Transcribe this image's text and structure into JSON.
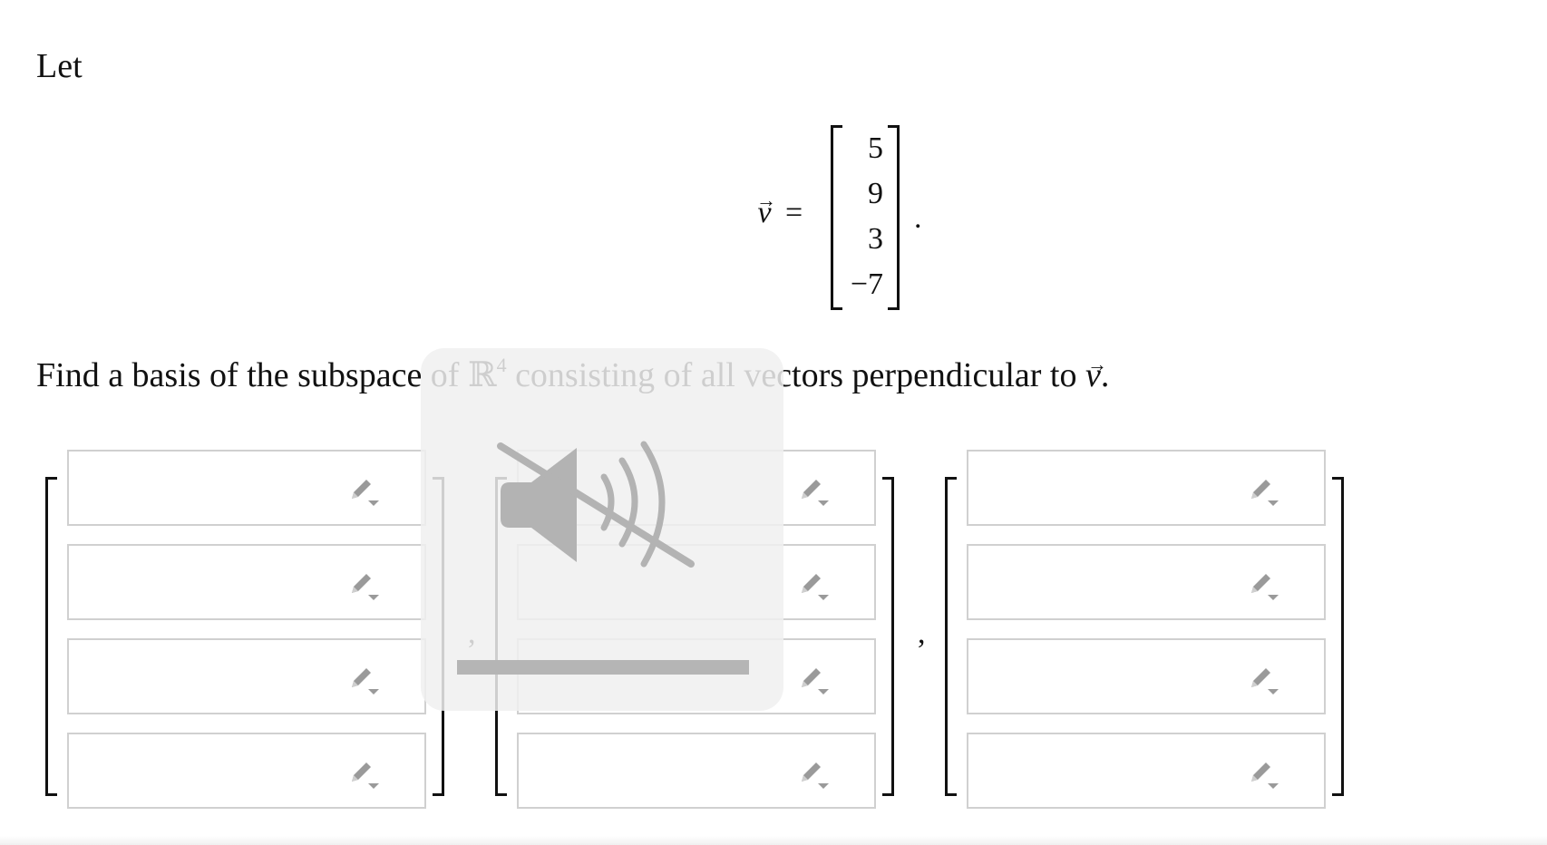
{
  "intro": "Let",
  "vector": {
    "symbol": "v",
    "arrow": "→",
    "equals": "=",
    "entries": [
      "5",
      "9",
      "3",
      "−7"
    ],
    "period": "."
  },
  "question": {
    "part1": "Find a basis of the subspace of ",
    "space": "ℝ",
    "exponent": "4",
    "part2": " consisting of all vectors perpendicular to ",
    "vref": "v",
    "arrow": "→",
    "end": "."
  },
  "separator": ",",
  "icons": {
    "pencil": "pencil-dropdown-icon",
    "muted": "speaker-muted-icon"
  },
  "colors": {
    "icon_gray": "#9a9a9a",
    "input_border": "#d0d0d0",
    "overlay_icon": "#b3b3b3"
  }
}
